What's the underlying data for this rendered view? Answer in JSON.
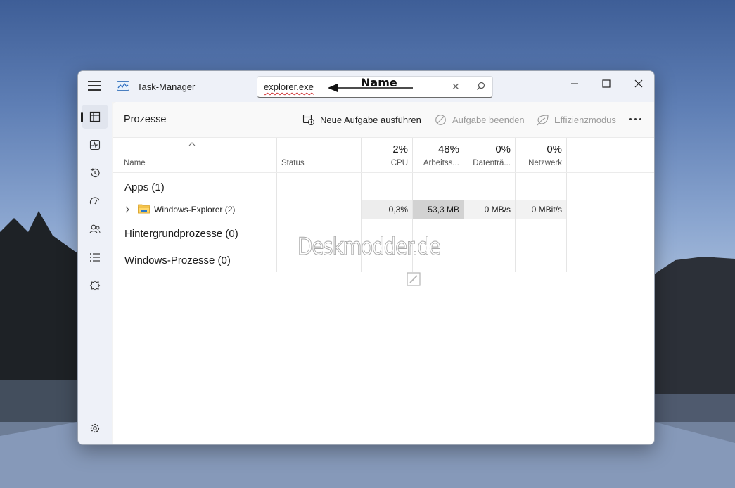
{
  "window": {
    "title": "Task-Manager"
  },
  "search": {
    "value": "explorer.exe"
  },
  "annotation": {
    "label": "Name"
  },
  "page": {
    "title": "Prozesse"
  },
  "toolbar": {
    "new_task": "Neue Aufgabe ausführen",
    "end_task": "Aufgabe beenden",
    "efficiency": "Effizienzmodus"
  },
  "columns": {
    "name": "Name",
    "status": "Status",
    "cpu": {
      "percent": "2%",
      "label": "CPU"
    },
    "memory": {
      "percent": "48%",
      "label": "Arbeitss..."
    },
    "disk": {
      "percent": "0%",
      "label": "Datenträ..."
    },
    "network": {
      "percent": "0%",
      "label": "Netzwerk"
    }
  },
  "groups": {
    "apps": "Apps (1)",
    "background": "Hintergrundprozesse (0)",
    "windows": "Windows-Prozesse (0)"
  },
  "process": {
    "name": "Windows-Explorer (2)",
    "cpu": "0,3%",
    "memory": "53,3 MB",
    "disk": "0 MB/s",
    "network": "0 MBit/s"
  },
  "watermark": "Deskmodder.de",
  "colors": {
    "cpu_cell": "#ededed",
    "memory_cell": "#d2d2d2",
    "light_cell": "#f2f2f2",
    "sidebar_bg": "#eef1f8"
  },
  "icons": {
    "nav": [
      "processes-icon",
      "performance-icon",
      "app-history-icon",
      "startup-apps-icon",
      "users-icon",
      "details-icon",
      "services-icon",
      "settings-icon"
    ]
  }
}
